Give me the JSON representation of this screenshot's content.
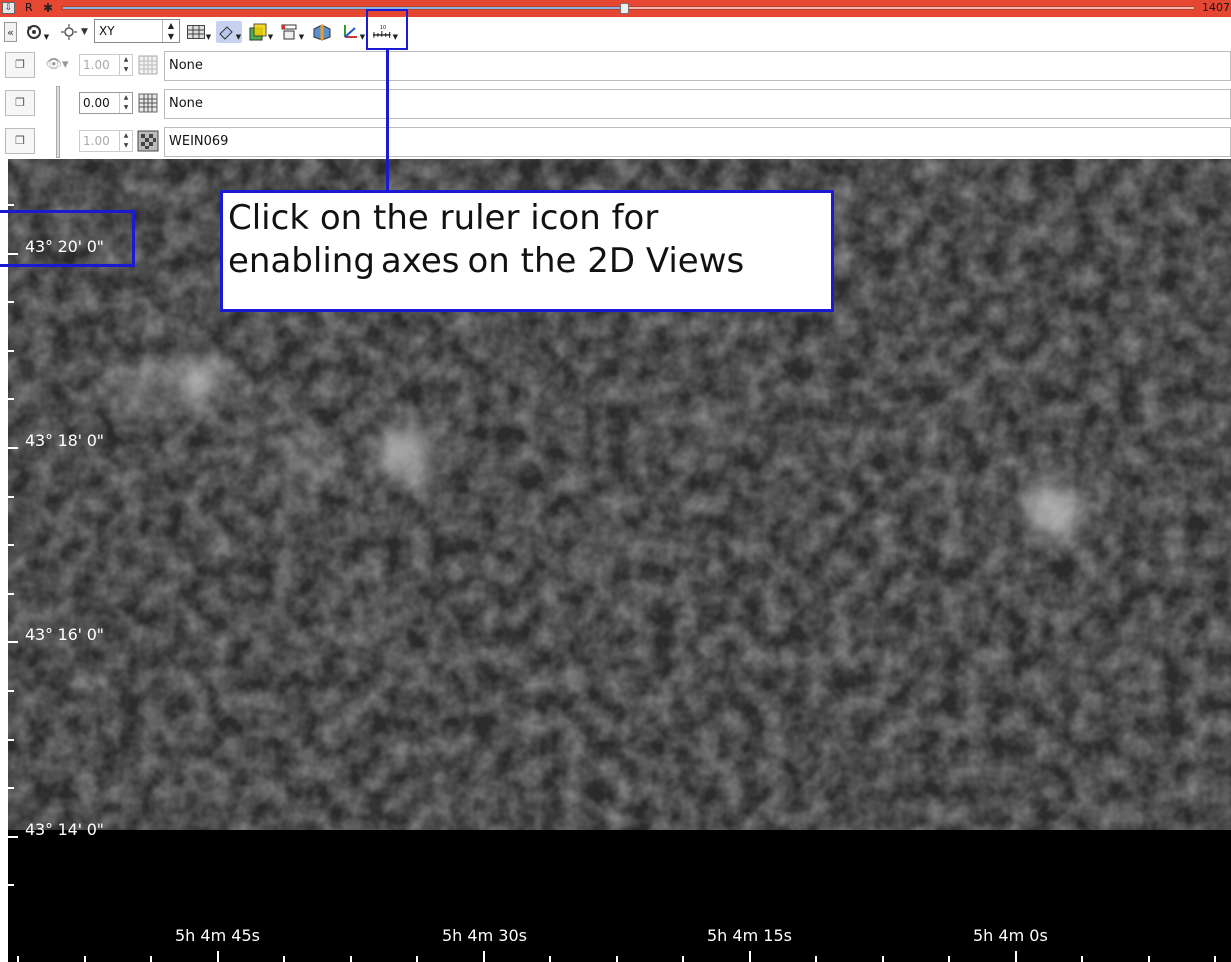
{
  "slice_bar": {
    "pin_glyph": "⇩",
    "label": "R",
    "slice_fraction": 0.496,
    "slice_count": "1407"
  },
  "toolbar": {
    "collapse_glyph": "«",
    "view_select": "XY",
    "view_select_arrows": "▲▼"
  },
  "layers": [
    {
      "opacity": "1.00",
      "opacity_enabled": false,
      "lut": "grid",
      "name": "None"
    },
    {
      "opacity": "0.00",
      "opacity_enabled": true,
      "lut": "grid-dark",
      "name": "None"
    },
    {
      "opacity": "1.00",
      "opacity_enabled": false,
      "lut": "checker",
      "name": "WEIN069"
    }
  ],
  "axes": {
    "dec_labels": [
      "43° 20'  0\"",
      "43° 18'  0\"",
      "43° 16'  0\"",
      "43° 14'  0\""
    ],
    "ra_labels": [
      "5h  4m 45s",
      "5h  4m 30s",
      "5h  4m 15s",
      "5h  4m  0s"
    ]
  },
  "callout": {
    "line1": "Click on the ruler icon for",
    "line2a": "enabling",
    "line2b": "axes",
    "line2c": "on the 2D Views"
  },
  "colors": {
    "slider_red": "#e64733",
    "highlight_blue": "#1a1ad0",
    "toolbar_bg": "#ffffff",
    "view_bg": "#000000"
  }
}
